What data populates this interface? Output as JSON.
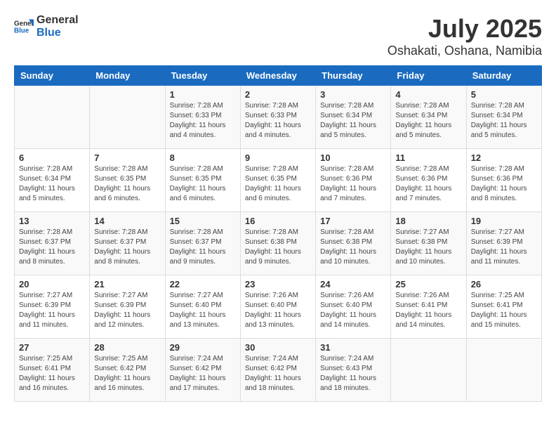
{
  "header": {
    "logo_general": "General",
    "logo_blue": "Blue",
    "month_year": "July 2025",
    "location": "Oshakati, Oshana, Namibia"
  },
  "days_of_week": [
    "Sunday",
    "Monday",
    "Tuesday",
    "Wednesday",
    "Thursday",
    "Friday",
    "Saturday"
  ],
  "weeks": [
    [
      {
        "day": "",
        "info": ""
      },
      {
        "day": "",
        "info": ""
      },
      {
        "day": "1",
        "info": "Sunrise: 7:28 AM\nSunset: 6:33 PM\nDaylight: 11 hours and 4 minutes."
      },
      {
        "day": "2",
        "info": "Sunrise: 7:28 AM\nSunset: 6:33 PM\nDaylight: 11 hours and 4 minutes."
      },
      {
        "day": "3",
        "info": "Sunrise: 7:28 AM\nSunset: 6:34 PM\nDaylight: 11 hours and 5 minutes."
      },
      {
        "day": "4",
        "info": "Sunrise: 7:28 AM\nSunset: 6:34 PM\nDaylight: 11 hours and 5 minutes."
      },
      {
        "day": "5",
        "info": "Sunrise: 7:28 AM\nSunset: 6:34 PM\nDaylight: 11 hours and 5 minutes."
      }
    ],
    [
      {
        "day": "6",
        "info": "Sunrise: 7:28 AM\nSunset: 6:34 PM\nDaylight: 11 hours and 5 minutes."
      },
      {
        "day": "7",
        "info": "Sunrise: 7:28 AM\nSunset: 6:35 PM\nDaylight: 11 hours and 6 minutes."
      },
      {
        "day": "8",
        "info": "Sunrise: 7:28 AM\nSunset: 6:35 PM\nDaylight: 11 hours and 6 minutes."
      },
      {
        "day": "9",
        "info": "Sunrise: 7:28 AM\nSunset: 6:35 PM\nDaylight: 11 hours and 6 minutes."
      },
      {
        "day": "10",
        "info": "Sunrise: 7:28 AM\nSunset: 6:36 PM\nDaylight: 11 hours and 7 minutes."
      },
      {
        "day": "11",
        "info": "Sunrise: 7:28 AM\nSunset: 6:36 PM\nDaylight: 11 hours and 7 minutes."
      },
      {
        "day": "12",
        "info": "Sunrise: 7:28 AM\nSunset: 6:36 PM\nDaylight: 11 hours and 8 minutes."
      }
    ],
    [
      {
        "day": "13",
        "info": "Sunrise: 7:28 AM\nSunset: 6:37 PM\nDaylight: 11 hours and 8 minutes."
      },
      {
        "day": "14",
        "info": "Sunrise: 7:28 AM\nSunset: 6:37 PM\nDaylight: 11 hours and 8 minutes."
      },
      {
        "day": "15",
        "info": "Sunrise: 7:28 AM\nSunset: 6:37 PM\nDaylight: 11 hours and 9 minutes."
      },
      {
        "day": "16",
        "info": "Sunrise: 7:28 AM\nSunset: 6:38 PM\nDaylight: 11 hours and 9 minutes."
      },
      {
        "day": "17",
        "info": "Sunrise: 7:28 AM\nSunset: 6:38 PM\nDaylight: 11 hours and 10 minutes."
      },
      {
        "day": "18",
        "info": "Sunrise: 7:27 AM\nSunset: 6:38 PM\nDaylight: 11 hours and 10 minutes."
      },
      {
        "day": "19",
        "info": "Sunrise: 7:27 AM\nSunset: 6:39 PM\nDaylight: 11 hours and 11 minutes."
      }
    ],
    [
      {
        "day": "20",
        "info": "Sunrise: 7:27 AM\nSunset: 6:39 PM\nDaylight: 11 hours and 11 minutes."
      },
      {
        "day": "21",
        "info": "Sunrise: 7:27 AM\nSunset: 6:39 PM\nDaylight: 11 hours and 12 minutes."
      },
      {
        "day": "22",
        "info": "Sunrise: 7:27 AM\nSunset: 6:40 PM\nDaylight: 11 hours and 13 minutes."
      },
      {
        "day": "23",
        "info": "Sunrise: 7:26 AM\nSunset: 6:40 PM\nDaylight: 11 hours and 13 minutes."
      },
      {
        "day": "24",
        "info": "Sunrise: 7:26 AM\nSunset: 6:40 PM\nDaylight: 11 hours and 14 minutes."
      },
      {
        "day": "25",
        "info": "Sunrise: 7:26 AM\nSunset: 6:41 PM\nDaylight: 11 hours and 14 minutes."
      },
      {
        "day": "26",
        "info": "Sunrise: 7:25 AM\nSunset: 6:41 PM\nDaylight: 11 hours and 15 minutes."
      }
    ],
    [
      {
        "day": "27",
        "info": "Sunrise: 7:25 AM\nSunset: 6:41 PM\nDaylight: 11 hours and 16 minutes."
      },
      {
        "day": "28",
        "info": "Sunrise: 7:25 AM\nSunset: 6:42 PM\nDaylight: 11 hours and 16 minutes."
      },
      {
        "day": "29",
        "info": "Sunrise: 7:24 AM\nSunset: 6:42 PM\nDaylight: 11 hours and 17 minutes."
      },
      {
        "day": "30",
        "info": "Sunrise: 7:24 AM\nSunset: 6:42 PM\nDaylight: 11 hours and 18 minutes."
      },
      {
        "day": "31",
        "info": "Sunrise: 7:24 AM\nSunset: 6:43 PM\nDaylight: 11 hours and 18 minutes."
      },
      {
        "day": "",
        "info": ""
      },
      {
        "day": "",
        "info": ""
      }
    ]
  ]
}
